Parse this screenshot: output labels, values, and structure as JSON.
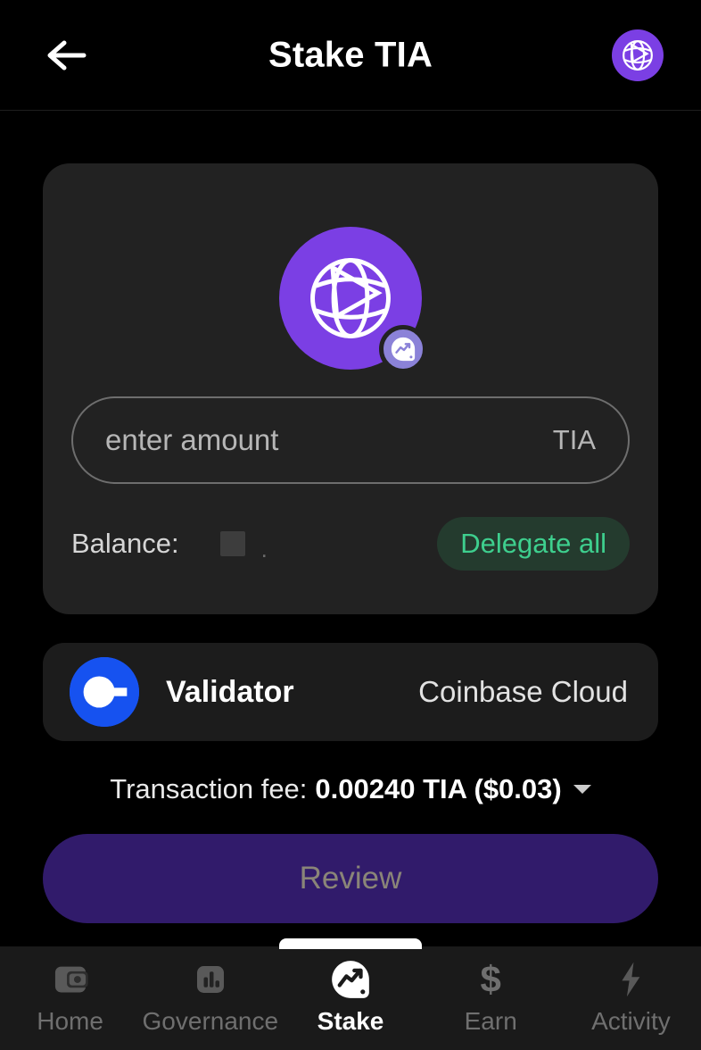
{
  "header": {
    "title": "Stake TIA",
    "back_icon": "arrow-left-icon",
    "logo_icon": "celestia-logo-icon"
  },
  "amount_card": {
    "token_logo_icon": "celestia-logo-icon",
    "token_badge_icon": "stake-chart-badge-icon",
    "input": {
      "value": "",
      "placeholder": "enter amount",
      "unit": "TIA"
    },
    "balance": {
      "label": "Balance:",
      "value": "",
      "loading_placeholder": "",
      "trailing_dot": "."
    },
    "delegate_all_label": "Delegate all"
  },
  "validator": {
    "avatar_icon": "coinbase-logo-icon",
    "label": "Validator",
    "value": "Coinbase Cloud"
  },
  "fee": {
    "label": "Transaction fee:",
    "value": "0.00240 TIA ($0.03)",
    "caret_icon": "chevron-down-icon"
  },
  "primary_action": {
    "label": "Review",
    "disabled": true
  },
  "bottom_nav": {
    "items": [
      {
        "label": "Home",
        "icon": "wallet-icon",
        "active": false
      },
      {
        "label": "Governance",
        "icon": "bar-chart-icon",
        "active": false
      },
      {
        "label": "Stake",
        "icon": "stake-chart-icon",
        "active": true
      },
      {
        "label": "Earn",
        "icon": "dollar-sign-icon",
        "active": false
      },
      {
        "label": "Activity",
        "icon": "lightning-bolt-icon",
        "active": false
      }
    ]
  },
  "colors": {
    "page_bg": "#000000",
    "card_bg": "#222222",
    "validator_card_bg": "#1c1c1c",
    "accent_purple": "#7B3FE4",
    "review_bg": "#311B6B",
    "green_accent": "#3ecf8e",
    "coinbase_blue": "#1652F0",
    "nav_bg": "#1a1a1a"
  }
}
